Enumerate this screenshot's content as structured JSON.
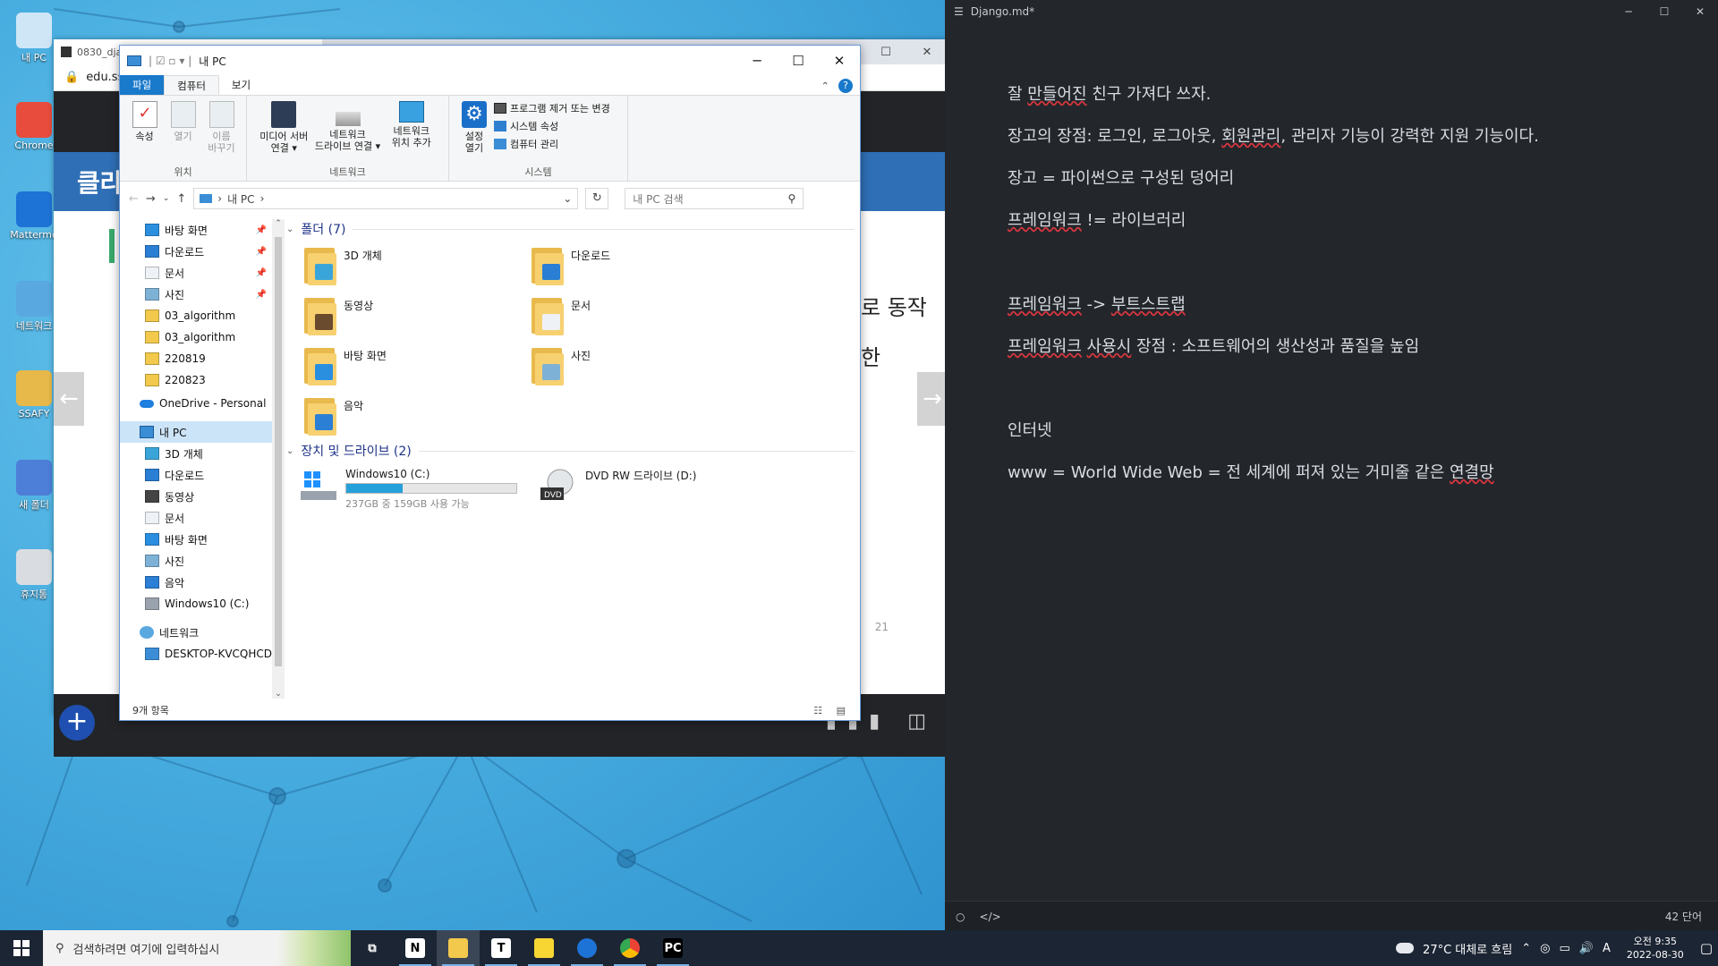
{
  "desktop": {
    "icons": [
      {
        "label": "내 PC",
        "icon": "computer-icon",
        "color": "#cfe6f7"
      },
      {
        "label": "Chrome",
        "icon": "chrome-icon",
        "color": "#e74c3c"
      },
      {
        "label": "Mattermo",
        "icon": "mattermost-icon",
        "color": "#1e73d6"
      },
      {
        "label": "네트워크",
        "icon": "network-icon",
        "color": "#5aa8e0"
      },
      {
        "label": "SSAFY",
        "icon": "user-folder-icon",
        "color": "#e7b84a"
      },
      {
        "label": "새 폴더",
        "icon": "folder-icon",
        "color": "#4d7ed8"
      },
      {
        "label": "휴지통",
        "icon": "recycle-bin-icon",
        "color": "#d9dde2"
      }
    ]
  },
  "browser": {
    "tab_title": "0830_dja",
    "url": "edu.ss",
    "header_text": "클라",
    "text_fragments": [
      "로 동작",
      "한"
    ],
    "page_number": "21",
    "colors": {
      "header_band": "#2f6fb5",
      "dark_band": "#222427"
    }
  },
  "explorer": {
    "title": "내 PC",
    "tabs": [
      "파일",
      "컴퓨터",
      "보기"
    ],
    "ribbon": {
      "location_group": {
        "label": "위치",
        "buttons": [
          "속성",
          "열기",
          "이름\n바꾸기"
        ]
      },
      "network_group": {
        "label": "네트워크",
        "buttons": [
          "미디어 서버\n연결 ▾",
          "네트워크\n드라이브 연결 ▾",
          "네트워크\n위치 추가"
        ]
      },
      "system_group": {
        "label": "시스템",
        "big_button": "설정\n열기",
        "small_buttons": [
          "프로그램 제거 또는 변경",
          "시스템 속성",
          "컴퓨터 관리"
        ]
      }
    },
    "address": {
      "path": [
        "내 PC"
      ],
      "search_placeholder": "내 PC 검색"
    },
    "nav": {
      "quick_access": [
        {
          "label": "바탕 화면",
          "icon": "desktop-folder-icon",
          "pinned": true
        },
        {
          "label": "다운로드",
          "icon": "download-arrow-icon",
          "pinned": true
        },
        {
          "label": "문서",
          "icon": "document-icon",
          "pinned": true
        },
        {
          "label": "사진",
          "icon": "pictures-icon",
          "pinned": true
        },
        {
          "label": "03_algorithm",
          "icon": "folder-icon",
          "pinned": false
        },
        {
          "label": "03_algorithm",
          "icon": "folder-icon",
          "pinned": false
        },
        {
          "label": "220819",
          "icon": "folder-icon",
          "pinned": false
        },
        {
          "label": "220823",
          "icon": "folder-icon",
          "pinned": false
        }
      ],
      "onedrive": "OneDrive - Personal",
      "this_pc": "내 PC",
      "this_pc_children": [
        {
          "label": "3D 개체",
          "icon": "3d-objects-icon"
        },
        {
          "label": "다운로드",
          "icon": "download-arrow-icon"
        },
        {
          "label": "동영상",
          "icon": "video-icon"
        },
        {
          "label": "문서",
          "icon": "document-icon"
        },
        {
          "label": "바탕 화면",
          "icon": "desktop-folder-icon"
        },
        {
          "label": "사진",
          "icon": "pictures-icon"
        },
        {
          "label": "음악",
          "icon": "music-icon"
        },
        {
          "label": "Windows10 (C:)",
          "icon": "drive-icon"
        }
      ],
      "network": "네트워크",
      "network_children": [
        {
          "label": "DESKTOP-KVCQHCD",
          "icon": "computer-icon"
        }
      ]
    },
    "folders_header": "폴더 (7)",
    "folders": [
      {
        "label": "3D 개체",
        "badge": "#3aa5d8"
      },
      {
        "label": "다운로드",
        "badge": "#2a7fd4"
      },
      {
        "label": "동영상",
        "badge": "#6b4b2e"
      },
      {
        "label": "문서",
        "badge": "#eef2f6"
      },
      {
        "label": "바탕 화면",
        "badge": "#2b8fe0"
      },
      {
        "label": "사진",
        "badge": "#7eb1d6"
      },
      {
        "label": "음악",
        "badge": "#2b7fd4"
      }
    ],
    "devices_header": "장치 및 드라이브 (2)",
    "drives": [
      {
        "label": "Windows10 (C:)",
        "sub": "237GB 중 159GB 사용 가능",
        "used_fraction": 0.33,
        "icon": "windows-drive-icon"
      },
      {
        "label": "DVD RW 드라이브 (D:)",
        "sub": "",
        "icon": "dvd-drive-icon"
      }
    ],
    "status": "9개 항목"
  },
  "editor": {
    "title": "Django.md*",
    "lines": [
      {
        "text": "잘 만들어진 친구 가져다 쓰자."
      },
      {
        "text": "장고의 장점: 로그인, 로그아웃, 회원관리, 관리자 기능이 강력한 지원 기능이다."
      },
      {
        "text": "장고 = 파이썬으로 구성된 덩어리"
      },
      {
        "text": "프레임워크 != 라이브러리"
      },
      {
        "text": ""
      },
      {
        "text": "프레임워크 -> 부트스트랩"
      },
      {
        "text": "프레임워크 사용시 장점 : 소프트웨어의 생산성과 품질을 높임"
      },
      {
        "text": ""
      },
      {
        "text": "인터넷"
      },
      {
        "text": "www = World Wide Web = 전 세계에 퍼져 있는 거미줄 같은 연결망"
      }
    ],
    "word_count": "42 단어",
    "colors": {
      "background": "#23262b",
      "spellcheck": "#d9363e"
    }
  },
  "taskbar": {
    "search_placeholder": "검색하려면 여기에 입력하십시",
    "apps": [
      {
        "name": "task-view-icon",
        "label": ""
      },
      {
        "name": "notion-icon",
        "label": "N"
      },
      {
        "name": "file-explorer-icon",
        "label": ""
      },
      {
        "name": "typora-icon",
        "label": "T"
      },
      {
        "name": "sticky-notes-icon",
        "label": ""
      },
      {
        "name": "mattermost-icon",
        "label": ""
      },
      {
        "name": "chrome-icon",
        "label": ""
      },
      {
        "name": "pycharm-icon",
        "label": "PC"
      }
    ],
    "weather": "27°C 대체로 흐림",
    "ime": "A",
    "time": "오전 9:35",
    "date": "2022-08-30"
  }
}
